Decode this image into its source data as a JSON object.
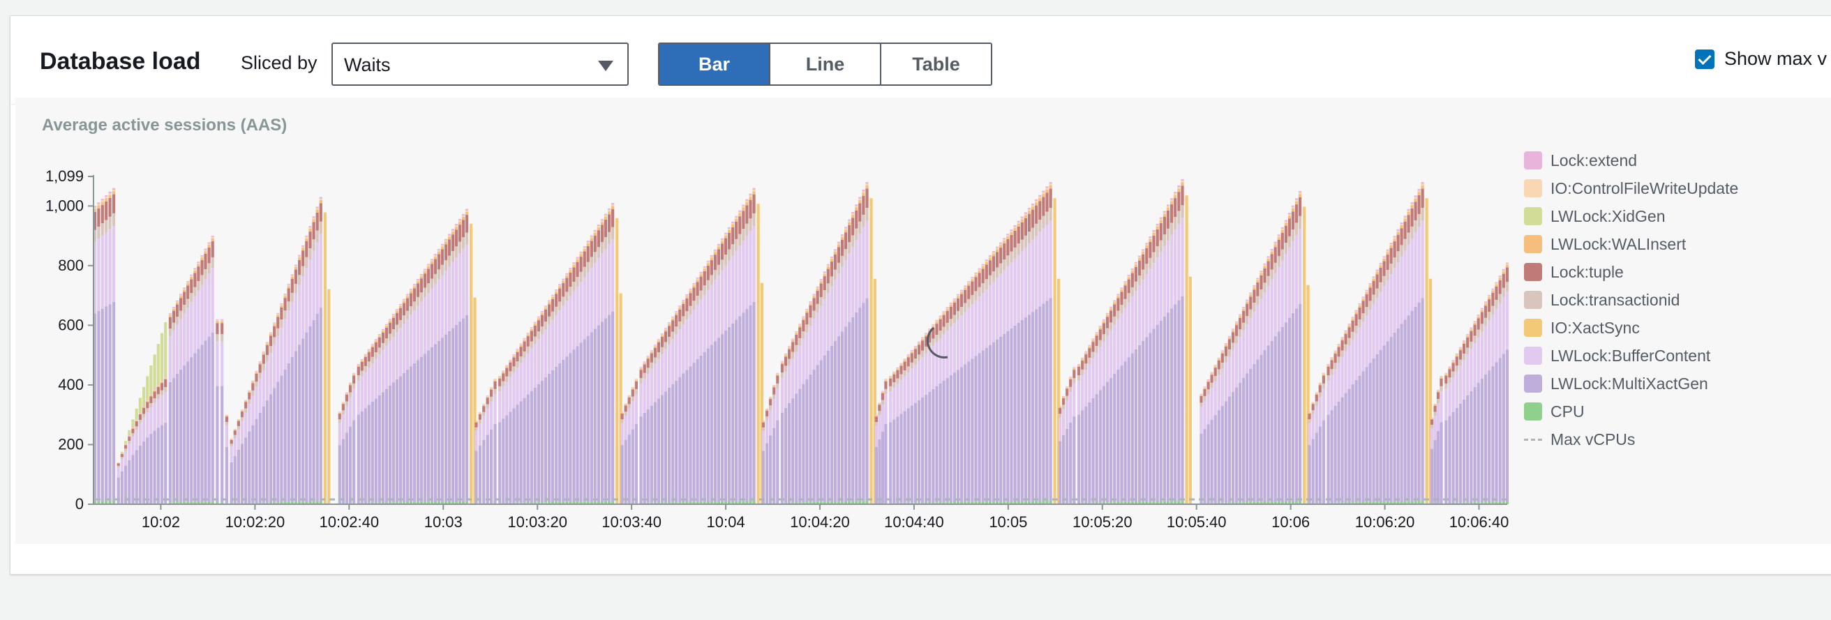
{
  "header": {
    "title": "Database load",
    "sliced_by_label": "Sliced by",
    "sliced_by_value": "Waits",
    "view_buttons": [
      {
        "label": "Bar",
        "active": true
      },
      {
        "label": "Line",
        "active": false
      },
      {
        "label": "Table",
        "active": false
      }
    ],
    "show_max_label": "Show max v",
    "show_max_checked": true
  },
  "colors": {
    "Lock:extend": "#e8b4dc",
    "IO:ControlFileWriteUpdate": "#f9d7b2",
    "LWLock:XidGen": "#d2dc96",
    "LWLock:WALInsert": "#f5be7c",
    "Lock:tuple": "#c07b78",
    "Lock:transactionid": "#d8c6bd",
    "IO:XactSync": "#f3c978",
    "LWLock:BufferContent": "#e2c9f0",
    "LWLock:MultiXactGen": "#bfaedb",
    "CPU": "#8fd08c",
    "Max vCPUs": "#aab7b8",
    "accent": "#2e6db8"
  },
  "chart_data": {
    "type": "bar",
    "stacked": true,
    "title": "Average active sessions (AAS)",
    "ylim": [
      0,
      1099
    ],
    "y_ticks": [
      "0",
      "200",
      "400",
      "600",
      "800",
      "1,000",
      "1,099"
    ],
    "y_tick_values": [
      0,
      200,
      400,
      600,
      800,
      1000,
      1099
    ],
    "x_ticks": [
      "10:02",
      "10:02:20",
      "10:02:40",
      "10:03",
      "10:03:20",
      "10:03:40",
      "10:04",
      "10:04:20",
      "10:04:40",
      "10:05",
      "10:05:20",
      "10:05:40",
      "10:06",
      "10:06:20",
      "10:06:40"
    ],
    "x_start_seconds": -14,
    "x_end_seconds": 286,
    "x_tick_seconds": [
      0,
      20,
      40,
      60,
      80,
      100,
      120,
      140,
      160,
      180,
      200,
      220,
      240,
      260,
      280
    ],
    "max_vcpus": 16,
    "legend": [
      "Lock:extend",
      "IO:ControlFileWriteUpdate",
      "LWLock:XidGen",
      "LWLock:WALInsert",
      "Lock:tuple",
      "Lock:transactionid",
      "IO:XactSync",
      "LWLock:BufferContent",
      "LWLock:MultiXactGen",
      "CPU",
      "Max vCPUs"
    ],
    "grid": false,
    "legend_position": "right",
    "segments": [
      {
        "start": -14,
        "end": -10,
        "from": 1000,
        "to": 1060,
        "xid": 0
      },
      {
        "start": -9,
        "end": 1,
        "from": 140,
        "to": 610,
        "xid": 0.3
      },
      {
        "start": 2,
        "end": 11,
        "from": 640,
        "to": 900,
        "xid": 0
      },
      {
        "start": 12,
        "end": 13,
        "from": 620,
        "to": 620,
        "xid": 0
      },
      {
        "start": 14,
        "end": 14,
        "from": 300,
        "to": 300,
        "xid": 0
      },
      {
        "start": 15,
        "end": 34,
        "from": 220,
        "to": 1030,
        "xid": 0
      },
      {
        "start": 38,
        "end": 41,
        "from": 310,
        "to": 440,
        "xid": 0
      },
      {
        "start": 42,
        "end": 65,
        "from": 470,
        "to": 990,
        "xid": 0
      },
      {
        "start": 67,
        "end": 71,
        "from": 280,
        "to": 420,
        "xid": 0
      },
      {
        "start": 72,
        "end": 96,
        "from": 430,
        "to": 1010,
        "xid": 0
      },
      {
        "start": 98,
        "end": 101,
        "from": 310,
        "to": 420,
        "xid": 0
      },
      {
        "start": 102,
        "end": 126,
        "from": 460,
        "to": 1060,
        "xid": 0
      },
      {
        "start": 128,
        "end": 131,
        "from": 280,
        "to": 440,
        "xid": 0
      },
      {
        "start": 132,
        "end": 150,
        "from": 480,
        "to": 1080,
        "xid": 0
      },
      {
        "start": 152,
        "end": 154,
        "from": 300,
        "to": 420,
        "xid": 0
      },
      {
        "start": 155,
        "end": 189,
        "from": 430,
        "to": 1080,
        "xid": 0
      },
      {
        "start": 191,
        "end": 194,
        "from": 330,
        "to": 460,
        "xid": 0
      },
      {
        "start": 195,
        "end": 217,
        "from": 470,
        "to": 1090,
        "xid": 0
      },
      {
        "start": 221,
        "end": 242,
        "from": 370,
        "to": 1050,
        "xid": 0
      },
      {
        "start": 244,
        "end": 247,
        "from": 310,
        "to": 440,
        "xid": 0
      },
      {
        "start": 248,
        "end": 268,
        "from": 470,
        "to": 1080,
        "xid": 0
      },
      {
        "start": 270,
        "end": 272,
        "from": 290,
        "to": 430,
        "xid": 0
      },
      {
        "start": 273,
        "end": 286,
        "from": 440,
        "to": 810,
        "xid": 0
      }
    ]
  }
}
